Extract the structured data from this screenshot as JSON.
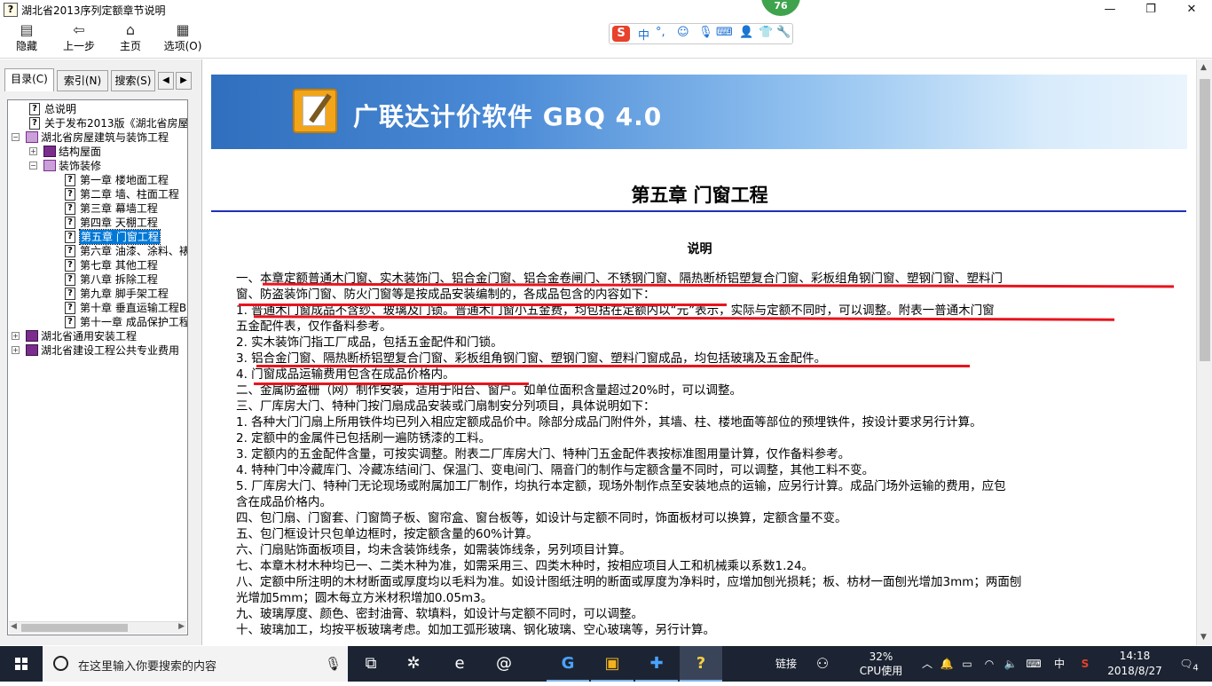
{
  "window": {
    "title": "湖北省2013序列定额章节说明",
    "badge": "76",
    "controls": {
      "minimize": "—",
      "maximize": "❐",
      "close": "✕"
    }
  },
  "toolbar": {
    "hide": "隐藏",
    "back": "上一步",
    "home": "主页",
    "options": "选项(O)"
  },
  "ime": {
    "logo": "S",
    "mode": "中",
    "punct": "°,",
    "icons": [
      "smiley-icon",
      "mic-icon",
      "keyboard-icon",
      "user-icon",
      "shirt-icon",
      "wrench-icon"
    ]
  },
  "tabs": {
    "contents": "目录(C)",
    "index": "索引(N)",
    "search": "搜索(S)"
  },
  "tree": [
    {
      "label": "总说明",
      "level": 2,
      "kind": "page"
    },
    {
      "label": "关于发布2013版《湖北省房屋",
      "level": 2,
      "kind": "page"
    },
    {
      "label": "湖北省房屋建筑与装饰工程",
      "level": 1,
      "kind": "book-open",
      "toggle": "−"
    },
    {
      "label": "结构屋面",
      "level": 2,
      "kind": "book",
      "toggle": "+"
    },
    {
      "label": "装饰装修",
      "level": 2,
      "kind": "book-open",
      "toggle": "−"
    },
    {
      "label": "第一章  楼地面工程",
      "level": 3,
      "kind": "page"
    },
    {
      "label": "第二章  墙、柱面工程",
      "level": 3,
      "kind": "page"
    },
    {
      "label": "第三章  幕墙工程",
      "level": 3,
      "kind": "page"
    },
    {
      "label": "第四章  天棚工程",
      "level": 3,
      "kind": "page"
    },
    {
      "label": "第五章  门窗工程",
      "level": 3,
      "kind": "page",
      "selected": true
    },
    {
      "label": "第六章  油漆、涂料、裱",
      "level": 3,
      "kind": "page"
    },
    {
      "label": "第七章  其他工程",
      "level": 3,
      "kind": "page"
    },
    {
      "label": "第八章  拆除工程",
      "level": 3,
      "kind": "page"
    },
    {
      "label": "第九章  脚手架工程",
      "level": 3,
      "kind": "page"
    },
    {
      "label": "第十章  垂直运输工程B",
      "level": 3,
      "kind": "page"
    },
    {
      "label": "第十一章  成品保护工程",
      "level": 3,
      "kind": "page"
    },
    {
      "label": "湖北省通用安装工程",
      "level": 1,
      "kind": "book",
      "toggle": "+"
    },
    {
      "label": "湖北省建设工程公共专业费用",
      "level": 1,
      "kind": "book",
      "toggle": "+"
    }
  ],
  "banner": {
    "title": "广联达计价软件 GBQ 4.0"
  },
  "doc": {
    "chapter": "第五章  门窗工程",
    "heading": "说明",
    "lines": [
      "一、本章定额普通木门窗、实木装饰门、铝合金门窗、铝合金卷闸门、不锈钢门窗、隔热断桥铝塑复合门窗、彩板组角钢门窗、塑钢门窗、塑料门",
      "窗、防盗装饰门窗、防火门窗等是按成品安装编制的，各成品包含的内容如下：",
      "1. 普通木门窗成品不含纱、玻璃及门锁。普通木门窗小五金费，均包括在定额内以“元”表示，实际与定额不同时，可以调整。附表一普通木门窗",
      "五金配件表，仅作备料参考。",
      "2. 实木装饰门指工厂成品，包括五金配件和门锁。",
      "3. 铝合金门窗、隔热断桥铝塑复合门窗、彩板组角钢门窗、塑钢门窗、塑料门窗成品，均包括玻璃及五金配件。",
      "4. 门窗成品运输费用包含在成品价格内。",
      "二、金属防盗栅（网）制作安装，适用于阳台、窗户。如单位面积含量超过20%时，可以调整。",
      "三、厂库房大门、特种门按门扇成品安装或门扇制安分列项目，具体说明如下：",
      "1. 各种大门门扇上所用铁件均已列入相应定额成品价中。除部分成品门附件外，其墙、柱、楼地面等部位的预埋铁件，按设计要求另行计算。",
      "2. 定额中的金属件已包括刷一遍防锈漆的工料。",
      "3. 定额内的五金配件含量，可按实调整。附表二厂库房大门、特种门五金配件表按标准图用量计算，仅作备料参考。",
      "4. 特种门中冷藏库门、冷藏冻结间门、保温门、变电间门、隔音门的制作与定额含量不同时，可以调整，其他工料不变。",
      "5. 厂库房大门、特种门无论现场或附属加工厂制作，均执行本定额，现场外制作点至安装地点的运输，应另行计算。成品门场外运输的费用，应包",
      "含在成品价格内。",
      "四、包门扇、门窗套、门窗筒子板、窗帘盒、窗台板等，如设计与定额不同时，饰面板材可以换算，定额含量不变。",
      "五、包门框设计只包单边框时，按定额含量的60%计算。",
      "六、门扇贴饰面板项目，均未含装饰线条，如需装饰线条，另列项目计算。",
      "七、本章木材木种均已一、二类木种为准，如需采用三、四类木种时，按相应项目人工和机械乘以系数1.24。",
      "八、定额中所注明的木材断面或厚度均以毛料为准。如设计图纸注明的断面或厚度为净料时，应增加刨光损耗；板、枋材一面刨光增加3mm；两面刨",
      "光增加5mm；圆木每立方米材积增加0.05m3。",
      "九、玻璃厚度、颜色、密封油膏、软填料，如设计与定额不同时，可以调整。",
      "十、玻璃加工，均按平板玻璃考虑。如加工弧形玻璃、钢化玻璃、空心玻璃等，另行计算。"
    ]
  },
  "taskbar": {
    "search_placeholder": "在这里输入你要搜索的内容",
    "apps": [
      "task-view-icon",
      "pinwheel-icon",
      "edge-icon",
      "swirl-icon",
      "g-app-icon",
      "notepad-icon",
      "plus-app-icon",
      "help-file-icon"
    ],
    "links": "链接",
    "cpu_percent": "32%",
    "cpu_label": "CPU使用",
    "ime_mode": "中",
    "time": "14:18",
    "date": "2018/8/27",
    "notifications": "4"
  },
  "colors": {
    "underline": "#e8141e",
    "rule": "#1f2fb8",
    "taskbar": "#1c2433",
    "selection": "#0078d7"
  }
}
